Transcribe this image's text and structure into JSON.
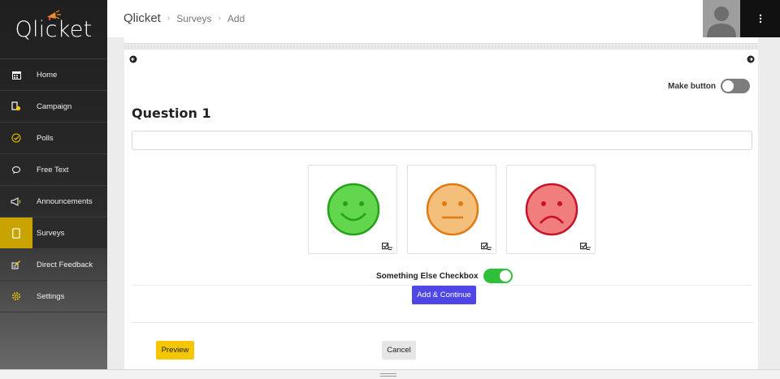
{
  "sidebar": {
    "logo": "Qlicket",
    "items": [
      {
        "label": "Home",
        "icon": "calendar-icon"
      },
      {
        "label": "Campaign",
        "icon": "document-badge-icon"
      },
      {
        "label": "Polls",
        "icon": "check-circle-icon"
      },
      {
        "label": "Free Text",
        "icon": "speech-bubble-icon"
      },
      {
        "label": "Announcements",
        "icon": "megaphone-icon"
      },
      {
        "label": "Surveys",
        "icon": "clipboard-icon",
        "active": true
      },
      {
        "label": "Direct Feedback",
        "icon": "edit-note-icon"
      },
      {
        "label": "Settings",
        "icon": "gear-icon"
      }
    ],
    "active_color": "#c9a400"
  },
  "header": {
    "brand": "Qlicket",
    "breadcrumb": [
      "Surveys",
      "Add"
    ]
  },
  "form": {
    "make_button_label": "Make button",
    "make_button_on": false,
    "question_title": "Question 1",
    "question_value": "",
    "faces": [
      {
        "mood": "happy",
        "color": "#62d64c",
        "stroke": "#25a11c"
      },
      {
        "mood": "neutral",
        "color": "#f4be7b",
        "stroke": "#e07a12"
      },
      {
        "mood": "sad",
        "color": "#f27d7d",
        "stroke": "#c8122a"
      }
    ],
    "something_else_label": "Something Else Checkbox",
    "something_else_on": true,
    "add_continue_label": "Add & Continue",
    "preview_label": "Preview",
    "cancel_label": "Cancel"
  },
  "colors": {
    "primary": "#4f46e5",
    "preview": "#f6c700",
    "toggle_on": "#2fbf3b"
  }
}
